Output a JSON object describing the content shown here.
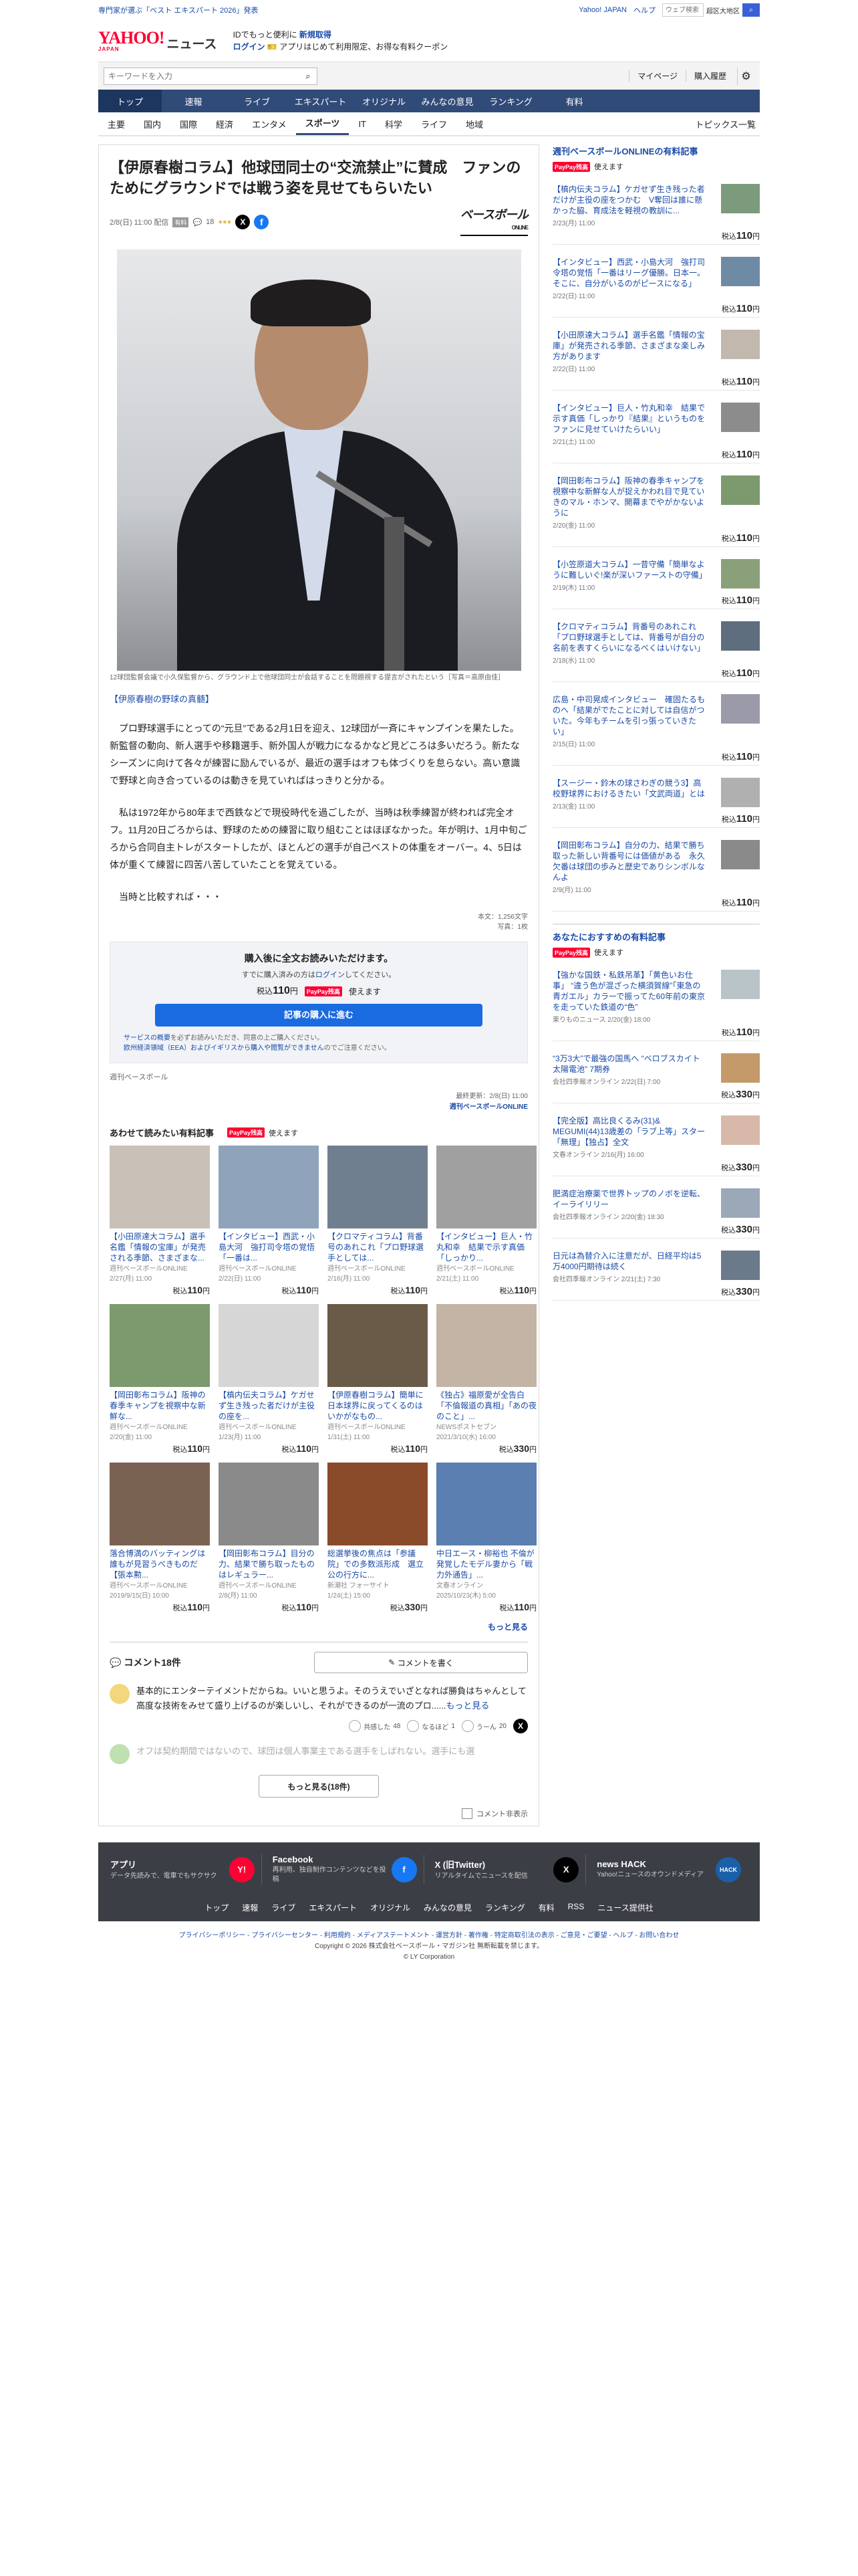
{
  "topbar": {
    "left_text": "専門家が選ぶ「ベスト エキスパート 2026」発表",
    "links": [
      "Yahoo! JAPAN",
      "ヘルプ"
    ],
    "search_placeholder": "ウェブ検索",
    "checkbox_label": "超区大地区",
    "search_button": "⌕"
  },
  "header": {
    "logo_text": "YAHOO!",
    "logo_sub": "JAPAN",
    "section": "ニュース",
    "promo_line1": "IDでもっと便利に",
    "promo_line1_link": "新規取得",
    "promo_line2_link": "ログイン",
    "promo_line2_text": "アプリはじめて利用限定、お得な有料クーポン"
  },
  "searchrow": {
    "placeholder": "キーワードを入力",
    "mypage": "マイページ",
    "purchase_history": "購入履歴"
  },
  "nav": {
    "items": [
      "トップ",
      "速報",
      "ライブ",
      "エキスパート",
      "オリジナル",
      "みんなの意見",
      "ランキング",
      "有料"
    ],
    "active": 0
  },
  "subnav": {
    "items": [
      "主要",
      "国内",
      "国際",
      "経済",
      "エンタメ",
      "スポーツ",
      "IT",
      "科学",
      "ライフ",
      "地域"
    ],
    "active": 5,
    "topics": "トピックス一覧"
  },
  "article": {
    "headline": "【伊原春樹コラム】他球団同士の“交流禁止”に賛成　ファンのためにグラウンドでは戦う姿を見せてもらいたい",
    "date": "2/8(日) 11:00 配信",
    "paid_badge": "有料",
    "comment_count": "18",
    "brand_name": "ベースボール",
    "brand_sub": "ONLINE",
    "photo_caption": "12球団監督会議で小久保監督から、グラウンド上で他球団同士が会話することを問題視する提言がされたという［写真＝高原由佳］",
    "series_link": "【伊原春樹の野球の真髄】",
    "paragraphs": [
      "プロ野球選手にとっての“元旦”である2月1日を迎え、12球団が一斉にキャンプインを果たした。新監督の動向、新人選手や移籍選手、新外国人が戦力になるかなど見どころは多いだろう。新たなシーズンに向けて各々が練習に励んでいるが、最近の選手はオフも体づくりを怠らない。高い意識で野球と向き合っているのは動きを見ていればはっきりと分かる。",
      "私は1972年から80年まで西鉄などで現役時代を過ごしたが、当時は秋季練習が終われば完全オフ。11月20日ごろからは、野球のための練習に取り組むことはほぼなかった。年が明け、1月中旬ごろから合同自主トレがスタートしたが、ほとんどの選手が自己ベストの体重をオーバー。4、5日は体が重くて練習に四苦八苦していたことを覚えている。",
      "当時と比較すれば・・・"
    ],
    "inline_link": "合同自主トレ",
    "stat_chars": "本文：1,256文字",
    "stat_photos": "写真：1枚"
  },
  "paywall": {
    "title": "購入後に全文お読みいただけます。",
    "subtitle_pre": "すでに購入済みの方は",
    "subtitle_link": "ログイン",
    "subtitle_post": "してください。",
    "price_pre": "税込",
    "price": "110",
    "price_unit": "円",
    "paypay": "PayPay残高",
    "paypay_post": "使えます",
    "button": "記事の購入に進む",
    "note1_link": "サービスの概要",
    "note1": "を必ずお読みいただき、同意の上ご購入ください。",
    "note2_link": "欧州経済領域（EEA）およびイギリスから購入や閲覧ができません",
    "note2": "のでご注意ください。",
    "source": "週刊ベースボール",
    "updated": "最終更新：2/8(日) 11:00",
    "publisher": "週刊ベースボールONLINE"
  },
  "related": {
    "heading": "あわせて読みたい有料記事",
    "paypay": "PayPay残高",
    "paypay_post": "使えます",
    "price_pre": "税込",
    "price_unit": "円",
    "cards": [
      {
        "title": "【小田原達大コラム】選手名鑑「情報の宝庫」が発売される季節、さまざまな...",
        "source": "週刊ベースボールONLINE",
        "date": "2/27(月) 11:00",
        "price": "110",
        "color": "#c9c1b8"
      },
      {
        "title": "【インタビュー】西武・小島大河　強打司令塔の覚悟「一番は...",
        "source": "週刊ベースボールONLINE",
        "date": "2/22(日) 11:00",
        "price": "110",
        "color": "#8fa4ba"
      },
      {
        "title": "【クロマティコラム】背番号のあれこれ「プロ野球選手としては...",
        "source": "週刊ベースボールONLINE",
        "date": "2/16(月) 11:00",
        "price": "110",
        "color": "#6f7f8f"
      },
      {
        "title": "【インタビュー】巨人・竹丸和幸　結果で示す真価「しっかり...",
        "source": "週刊ベースボールONLINE",
        "date": "2/21(土) 11:00",
        "price": "110",
        "color": "#a0a0a0"
      },
      {
        "title": "【岡田彰布コラム】阪神の春季キャンプを視察中な新鮮な...",
        "source": "週刊ベースボールONLINE",
        "date": "2/20(金) 11:00",
        "price": "110",
        "color": "#7c9a6e"
      },
      {
        "title": "【槙内伝夫コラム】ケガせず生き残った者だけが主役の座を...",
        "source": "週刊ベースボールONLINE",
        "date": "1/23(月) 11:00",
        "price": "110",
        "color": "#d6d6d6"
      },
      {
        "title": "【伊原春樹コラム】簡単に日本球界に戻ってくるのはいかがなもの...",
        "source": "週刊ベースボールONLINE",
        "date": "1/31(土) 11:00",
        "price": "110",
        "color": "#6a5a48"
      },
      {
        "title": "《独占》福原愛が全告白「不倫報道の真相」「あの夜のこと」...",
        "source": "NEWSポストセブン",
        "date": "2021/3/10(水) 16:00",
        "price": "330",
        "color": "#c3b4a6"
      },
      {
        "title": "落合博満のバッティングは誰もが見習うべきものだ【張本勲...",
        "source": "週刊ベースボールONLINE",
        "date": "2019/9/15(日) 10:00",
        "price": "110",
        "color": "#7a6252"
      },
      {
        "title": "【岡田彰布コラム】目分の力、結果で勝ち取ったものはレギュラー...",
        "source": "週刊ベースボールONLINE",
        "date": "2/8(月) 11:00",
        "price": "110",
        "color": "#8a8a8a"
      },
      {
        "title": "総選挙後の焦点は「参議院」での多数派形成　選立公の行方に...",
        "source": "新潮社 フォーサイト",
        "date": "1/24(土) 15:00",
        "price": "330",
        "color": "#8a4b2a"
      },
      {
        "title": "中日エース・柳裕也 不倫が発覚したモデル妻から「戦力外通告」...",
        "source": "文春オンライン",
        "date": "2025/10/23(木) 5:00",
        "price": "110",
        "color": "#5a7fb0"
      }
    ],
    "more": "もっと見る"
  },
  "comments": {
    "title": "コメント18件",
    "write": "コメントを書く",
    "items": [
      {
        "text": "基本的にエンターテイメントだからね。いいと思うよ。そのうえでいざとなれば勝負はちゃんとして高度な技術をみせて盛り上げるのが楽しいし、それができるのが一流のプロ......",
        "more": "もっと見る",
        "reacts": [
          [
            "共感した",
            "48"
          ],
          [
            "なるほど",
            "1"
          ],
          [
            "うーん",
            "20"
          ]
        ]
      }
    ],
    "faded": "オフは契約期間ではないので、球団は個人事業主である選手をしばれない。選手にも選",
    "more_button": "もっと見る(18件)",
    "toggle": "コメント非表示"
  },
  "sidebar": {
    "section1_title": "週刊ベースボールONLINEの有料記事",
    "paypay": "PayPay残高",
    "paypay_post": "使えます",
    "price_pre": "税込",
    "price_unit": "円",
    "items1": [
      {
        "title": "【槙内伝夫コラム】ケガせず生き残った者だけが主役の座をつかむ　V奪回は誰に懸かった脇、育成法を軽視の教訓に...",
        "date": "2/23(月) 11:00",
        "price": "110",
        "color": "#7c9a7c"
      },
      {
        "title": "【インタビュー】西武・小島大河　強打司令塔の覚悟「一番はリーグ優勝。日本一。そこに、自分がいるのがピースになる」",
        "date": "2/22(日) 11:00",
        "price": "110",
        "color": "#6f8aa4"
      },
      {
        "title": "【小田原達大コラム】選手名鑑「情報の宝庫」が発売される季節、さまざまな楽しみ方があります",
        "date": "2/22(日) 11:00",
        "price": "110",
        "color": "#c2b8ad"
      },
      {
        "title": "【インタビュー】巨人・竹丸和幸　結果で示す真価「しっかり『結果』というものをファンに見せていけたらいい」",
        "date": "2/21(土) 11:00",
        "price": "110",
        "color": "#8c8c8c"
      },
      {
        "title": "【岡田彰布コラム】阪神の春季キャンプを視察中な新鮮な人が捉えかわれ目で見ていきのマル・ホンマ、開幕までやがかないように",
        "date": "2/20(金) 11:00",
        "price": "110",
        "color": "#7c9a6e"
      },
      {
        "title": "【小笠原道大コラム】一昔守備「簡単なように難しいぐ!楽が深いファーストの守備」",
        "date": "2/19(木) 11:00",
        "price": "110",
        "color": "#8aa07a"
      },
      {
        "title": "【クロマティコラム】背番号のあれこれ「プロ野球選手としては、背番号が自分の名前を表すくらいになるべくはいけない」",
        "date": "2/18(水) 11:00",
        "price": "110",
        "color": "#5e6e7e"
      },
      {
        "title": "広島・中司晃成インタビュー　確固たるものへ「結果がでたことに対しては自信がついた。今年もチームを引っ張っていきたい」",
        "date": "2/15(日) 11:00",
        "price": "110",
        "color": "#9a9aa8"
      },
      {
        "title": "【スージー・鈴木の球さわぎの競う3】高校野球界におけるきたい「文武両道」とは",
        "date": "2/13(金) 11:00",
        "price": "110",
        "color": "#b0b0b0"
      },
      {
        "title": "【岡田彰布コラム】自分の力、結果で勝ち取った新しい背番号には価値がある　永久欠番は球団の歩みと歴史でありシンボルなんよ",
        "date": "2/9(月) 11:00",
        "price": "110",
        "color": "#8a8a8a"
      }
    ],
    "section2_title": "あなたにおすすめの有料記事",
    "items2": [
      {
        "title": "【強かな国鉄・私鉄吊革】「黄色いお仕事」 “違う色が混ざった横須賀線”「東急の青ガエル」カラーで振ってた60年前の東京を走っていた鉄道の“色”",
        "source": "東りものニュース",
        "date": "2/20(金) 18:00",
        "price": "110",
        "color": "#b8c4c8"
      },
      {
        "title": "“3万3大”で最強の国馬へ “ベロブスカイト太陽電池” 7期券",
        "source": "会社四季報オンライン",
        "date": "2/22(日) 7:00",
        "price": "330",
        "color": "#c49a6a"
      },
      {
        "title": "【完全版】高比良くるみ(31)& MEGUMI(44)13歳差の「ラブ上等」スター「無理」【独占】全文",
        "source": "文春オンライン",
        "date": "2/16(月) 16:00",
        "price": "330",
        "color": "#d8b8a8"
      },
      {
        "title": "肥満症治療薬で世界トップのノボを逆転、イーライリリー",
        "source": "会社四季報オンライン",
        "date": "2/20(金) 18:30",
        "price": "330",
        "color": "#9aa8b8"
      },
      {
        "title": "日元は為替介入に注意だが、日経平均は5万4000円期待は続く",
        "source": "会社四季報オンライン",
        "date": "2/21(土) 7:30",
        "price": "330",
        "color": "#6a7a8a"
      }
    ]
  },
  "footer": {
    "apps": [
      {
        "name": "アプリ",
        "desc": "データ先読みで、電車でもサクサク",
        "icon": "Y!",
        "color": "#ff0033"
      },
      {
        "name": "Facebook",
        "desc": "再利用、独自制作コンテンツなどを投稿",
        "icon": "f",
        "color": "#1877f2"
      },
      {
        "name": "X (旧Twitter)",
        "desc": "リアルタイムでニュースを配信",
        "icon": "X",
        "color": "#000000"
      },
      {
        "name": "news HACK",
        "desc": "Yahoo!ニュースのオウンドメディア",
        "icon": "HACK",
        "color": "#1b5fa8"
      }
    ],
    "nav": [
      "トップ",
      "速報",
      "ライブ",
      "エキスパート",
      "オリジナル",
      "みんなの意見",
      "ランキング",
      "有料",
      "RSS",
      "ニュース提供社"
    ],
    "legal_links": "プライバシーポリシー - プライバシーセンター - 利用規約 - メディアステートメント - 運営方針 - 著作権 - 特定商取引法の表示 - ご意見・ご要望 - ヘルプ - お問い合わせ",
    "copyright1": "Copyright © 2026 株式会社ベースボール・マガジン社 無断転載を禁じます。",
    "copyright2": "© LY Corporation"
  }
}
